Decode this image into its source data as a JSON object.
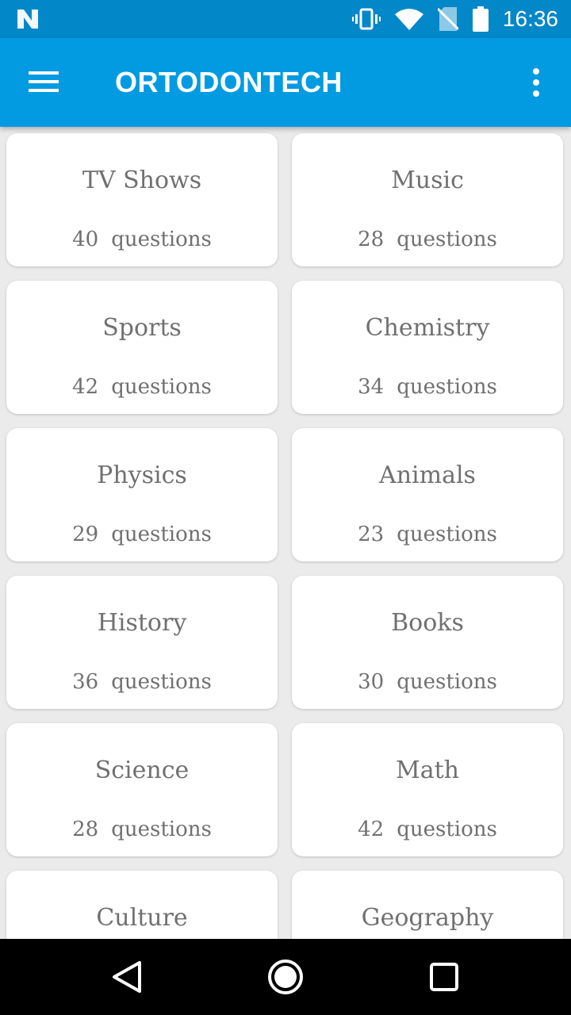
{
  "status_bar": {
    "time": "16:36",
    "icons": [
      "app-n-icon",
      "vibrate-icon",
      "wifi-icon",
      "no-sim-icon",
      "battery-icon"
    ]
  },
  "app_bar": {
    "title": "ORTODONTECH",
    "icons": [
      "hamburger-menu-icon",
      "more-vertical-icon"
    ]
  },
  "categories": [
    {
      "name": "TV Shows",
      "count": "40",
      "unit": "questions"
    },
    {
      "name": "Music",
      "count": "28",
      "unit": "questions"
    },
    {
      "name": "Sports",
      "count": "42",
      "unit": "questions"
    },
    {
      "name": "Chemistry",
      "count": "34",
      "unit": "questions"
    },
    {
      "name": "Physics",
      "count": "29",
      "unit": "questions"
    },
    {
      "name": "Animals",
      "count": "23",
      "unit": "questions"
    },
    {
      "name": "History",
      "count": "36",
      "unit": "questions"
    },
    {
      "name": "Books",
      "count": "30",
      "unit": "questions"
    },
    {
      "name": "Science",
      "count": "28",
      "unit": "questions"
    },
    {
      "name": "Math",
      "count": "42",
      "unit": "questions"
    },
    {
      "name": "Culture",
      "count": "",
      "unit": ""
    },
    {
      "name": "Geography",
      "count": "",
      "unit": ""
    }
  ],
  "nav_bar": {
    "icons": [
      "back-icon",
      "home-icon",
      "recents-icon"
    ]
  },
  "colors": {
    "status_bar": "#0287c9",
    "app_bar": "#029be1",
    "background": "#ebebeb",
    "card": "#ffffff",
    "card_text": "#707070"
  }
}
